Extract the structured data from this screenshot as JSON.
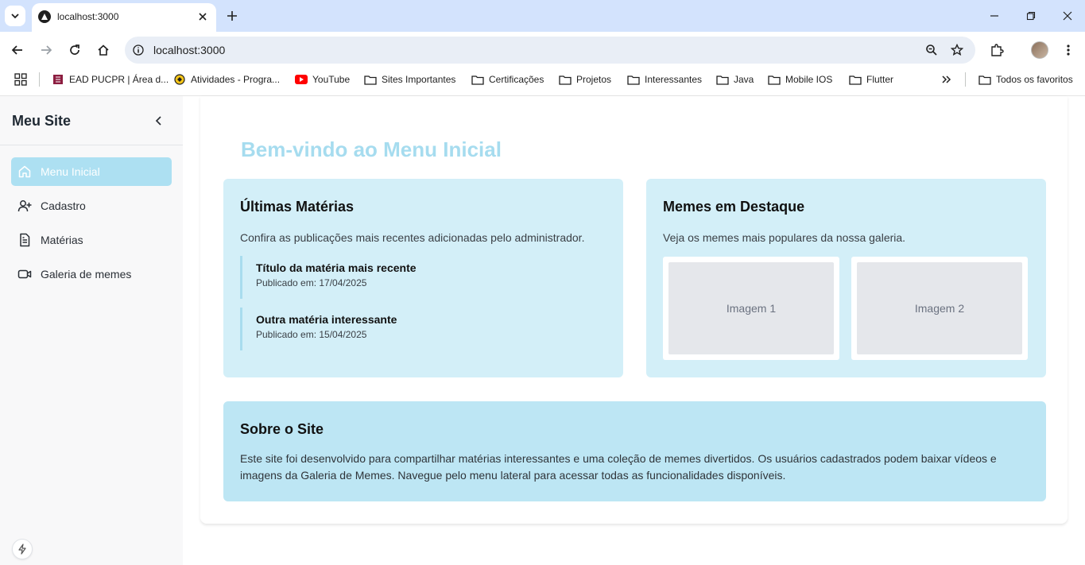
{
  "browser": {
    "tab_title": "localhost:3000",
    "url": "localhost:3000",
    "bookmarks": [
      {
        "label": "EAD PUCPR | Área d...",
        "icon": "pucpr-icon"
      },
      {
        "label": "Atividades - Progra...",
        "icon": "site-icon"
      },
      {
        "label": "YouTube",
        "icon": "youtube-icon"
      },
      {
        "label": "Sites Importantes",
        "icon": "folder-icon"
      },
      {
        "label": "Certificações",
        "icon": "folder-icon"
      },
      {
        "label": "Projetos",
        "icon": "folder-icon"
      },
      {
        "label": "Interessantes",
        "icon": "folder-icon"
      },
      {
        "label": "Java",
        "icon": "folder-icon"
      },
      {
        "label": "Mobile IOS",
        "icon": "folder-icon"
      },
      {
        "label": "Flutter",
        "icon": "folder-icon"
      }
    ],
    "all_bookmarks_label": "Todos os favoritos"
  },
  "sidebar": {
    "title": "Meu Site",
    "items": [
      {
        "label": "Menu Inicial",
        "icon": "home-icon",
        "active": true
      },
      {
        "label": "Cadastro",
        "icon": "user-plus-icon",
        "active": false
      },
      {
        "label": "Matérias",
        "icon": "document-icon",
        "active": false
      },
      {
        "label": "Galeria de memes",
        "icon": "video-icon",
        "active": false
      }
    ]
  },
  "main": {
    "heading": "Bem-vindo ao Menu Inicial",
    "news_card": {
      "title": "Últimas Matérias",
      "description": "Confira as publicações mais recentes adicionadas pelo administrador.",
      "items": [
        {
          "title": "Título da matéria mais recente",
          "date": "Publicado em: 17/04/2025"
        },
        {
          "title": "Outra matéria interessante",
          "date": "Publicado em: 15/04/2025"
        }
      ]
    },
    "memes_card": {
      "title": "Memes em Destaque",
      "description": "Veja os memes mais populares da nossa galeria.",
      "images": [
        "Imagem 1",
        "Imagem 2"
      ]
    },
    "about_card": {
      "title": "Sobre o Site",
      "text": "Este site foi desenvolvido para compartilhar matérias interessantes e uma coleção de memes divertidos. Os usuários cadastrados podem baixar vídeos e imagens da Galeria de Memes. Navegue pelo menu lateral para acessar todas as funcionalidades disponíveis."
    }
  },
  "colors": {
    "accent": "#ade0f2",
    "heading": "#a6dcef",
    "card_bg": "#d3eff8",
    "about_bg": "#bde6f4",
    "tabstrip": "#d3e3fd"
  }
}
